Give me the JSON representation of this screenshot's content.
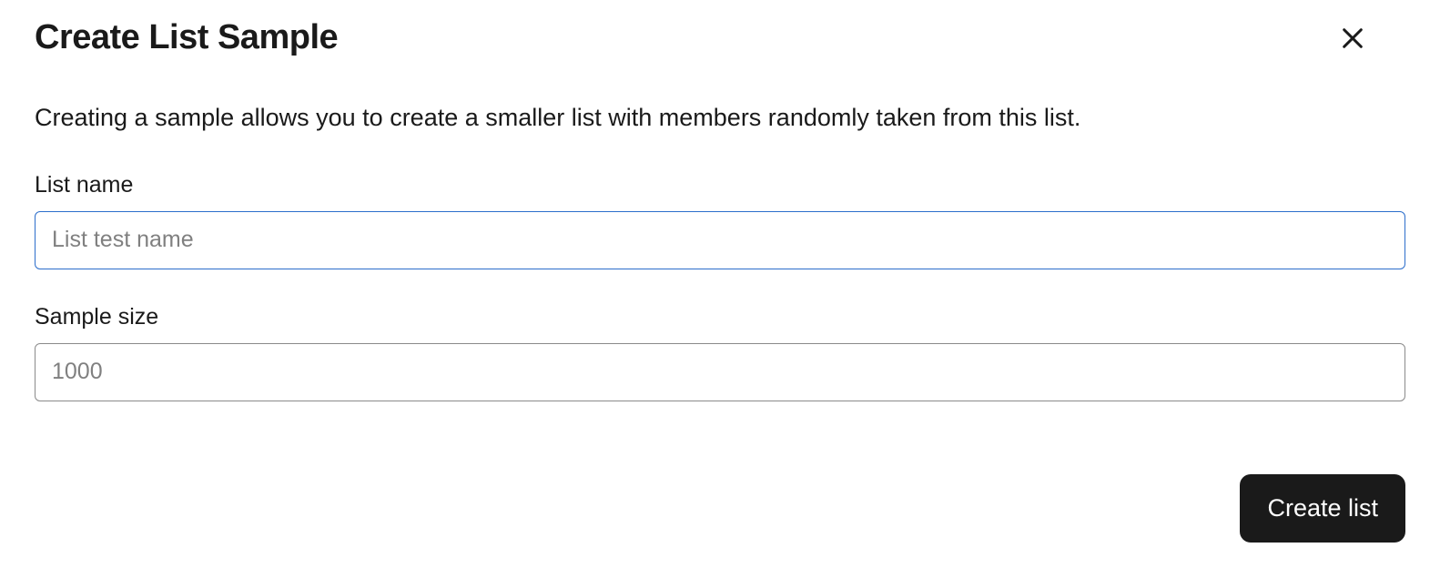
{
  "header": {
    "title": "Create List Sample"
  },
  "description": "Creating a sample allows you to create a smaller list with members randomly taken from this list.",
  "form": {
    "list_name": {
      "label": "List name",
      "placeholder": "List test name",
      "value": ""
    },
    "sample_size": {
      "label": "Sample size",
      "placeholder": "1000",
      "value": ""
    }
  },
  "actions": {
    "create_label": "Create list"
  }
}
